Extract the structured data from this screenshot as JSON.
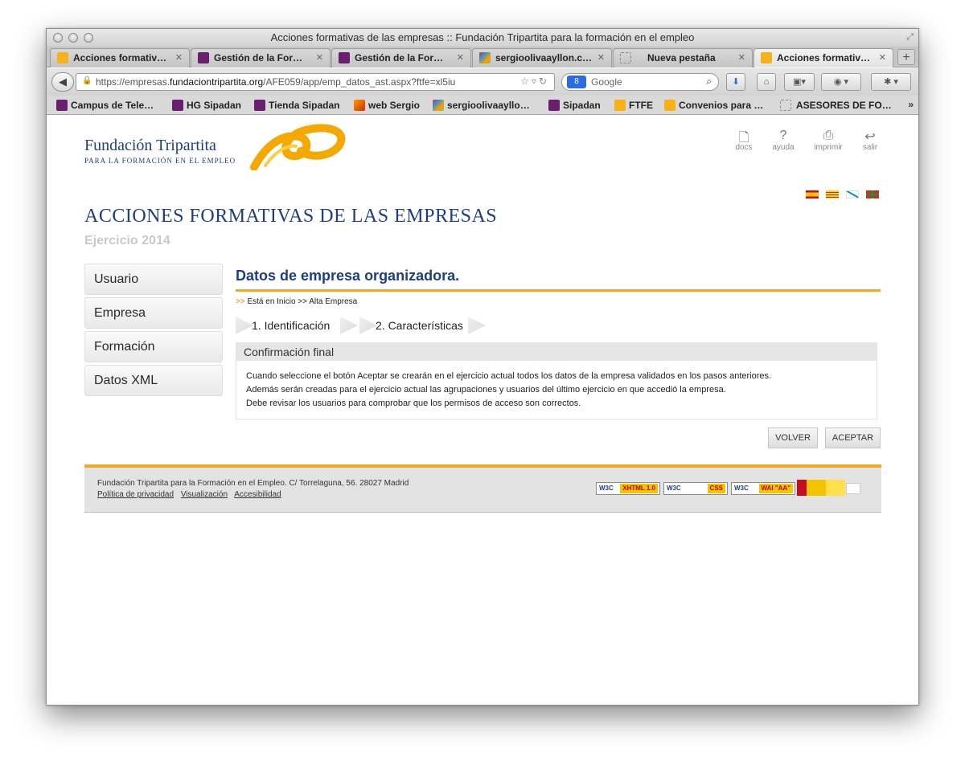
{
  "window": {
    "title": "Acciones formativas de las empresas :: Fundación Tripartita para la formación en el empleo"
  },
  "tabs": [
    {
      "label": "Acciones formativ…",
      "icon": "ft-logo-icon"
    },
    {
      "label": "Gestión de la For…",
      "icon": "power-icon"
    },
    {
      "label": "Gestión de la For…",
      "icon": "power-icon"
    },
    {
      "label": "sergioolivaayllon.c…",
      "icon": "joomla-icon"
    },
    {
      "label": "Nueva pestaña",
      "icon": "blank-icon"
    },
    {
      "label": "Acciones formativ…",
      "icon": "ft-logo-icon"
    }
  ],
  "url": {
    "prefix": "https://empresas.",
    "domain": "fundaciontripartita.org",
    "path": "/AFE059/app/emp_datos_ast.aspx?ftfe=xl5iu"
  },
  "search": {
    "engine": "8",
    "placeholder": "Google"
  },
  "bookmarks": [
    {
      "label": "Campus de Tele…",
      "icon": "power-icon"
    },
    {
      "label": "HG Sipadan",
      "icon": "power-icon"
    },
    {
      "label": "Tienda Sipadan",
      "icon": "power-icon"
    },
    {
      "label": "web Sergio",
      "icon": "web-icon"
    },
    {
      "label": "sergioolivaayllo…",
      "icon": "joomla-icon"
    },
    {
      "label": "Sipadan",
      "icon": "power-icon"
    },
    {
      "label": "FTFE",
      "icon": "ft-logo-icon"
    },
    {
      "label": "Convenios para …",
      "icon": "ft-logo-icon"
    },
    {
      "label": "ASESORES DE FO…",
      "icon": "blank-icon"
    }
  ],
  "header": {
    "org_name": "Fundación Tripartita",
    "org_sub": "PARA LA FORMACIÓN EN EL EMPLEO",
    "tools": [
      {
        "label": "docs",
        "icon": "document-icon"
      },
      {
        "label": "ayuda",
        "icon": "help-icon"
      },
      {
        "label": "imprimir",
        "icon": "print-icon"
      },
      {
        "label": "salir",
        "icon": "exit-icon"
      }
    ],
    "title": "ACCIONES FORMATIVAS DE LAS EMPRESAS",
    "year": "Ejercicio 2014"
  },
  "sidebar": {
    "items": [
      "Usuario",
      "Empresa",
      "Formación",
      "Datos XML"
    ]
  },
  "main": {
    "title": "Datos de empresa organizadora.",
    "breadcrumb_arrow": ">>",
    "breadcrumb": "Está en Inicio >> Alta Empresa",
    "steps": [
      "1. Identificación",
      "2. Características"
    ],
    "confirm_title": "Confirmación final",
    "confirm_lines": [
      "Cuando seleccione el botón Aceptar se crearán en el ejercicio actual todos los datos de la empresa validados en los pasos anteriores.",
      "Además serán creadas para el ejercicio actual las agrupaciones y usuarios del último ejercicio en que accedió la empresa.",
      "Debe revisar los usuarios para comprobar que los permisos de acceso son correctos."
    ],
    "back_label": "VOLVER",
    "accept_label": "ACEPTAR"
  },
  "footer": {
    "address": "Fundación Tripartita para la Formación en el Empleo. C/ Torrelaguna, 56. 28027 Madrid",
    "links": [
      "Política de privacidad",
      "Visualización",
      "Accesibilidad"
    ],
    "badges": [
      {
        "w3c": "W3C",
        "label": "XHTML 1.0"
      },
      {
        "w3c": "W3C",
        "label": "CSS"
      },
      {
        "w3c": "W3C",
        "label": "WAI \"AA\""
      }
    ]
  },
  "colors": {
    "brand_blue": "#1e3c87",
    "accent_orange": "#f5a623"
  }
}
